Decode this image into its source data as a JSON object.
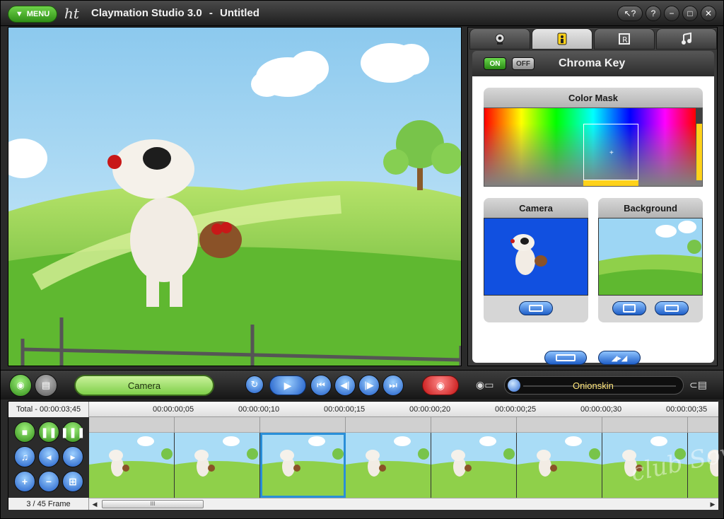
{
  "titlebar": {
    "menu_label": "MENU",
    "logo": "ht",
    "app_name": "Claymation Studio 3.0",
    "separator": "-",
    "document": "Untitled",
    "help_icon": "context-help-icon"
  },
  "right_panel": {
    "tabs": [
      {
        "icon": "webcam-icon",
        "active": false
      },
      {
        "icon": "person-icon",
        "active": true
      },
      {
        "icon": "frame-r-icon",
        "active": false
      },
      {
        "icon": "music-icon",
        "active": false
      }
    ],
    "chroma_key": {
      "on_label": "ON",
      "off_label": "OFF",
      "title": "Chroma Key",
      "color_mask_label": "Color Mask",
      "camera_label": "Camera",
      "background_label": "Background"
    }
  },
  "controls": {
    "camera_pill": "Camera",
    "onionskin_label": "Onionskin"
  },
  "timeline": {
    "total": "Total - 00:00:03;45",
    "ticks": [
      "00:00:00;05",
      "00:00:00;10",
      "00:00:00;15",
      "00:00:00;20",
      "00:00:00;25",
      "00:00:00;30",
      "00:00:00;35"
    ],
    "frame_count": "3 / 45 Frame",
    "selected_frame": 3,
    "scroll_thumb": "III"
  },
  "watermark": "club Sovet",
  "colors": {
    "accent_green": "#4fbf2a",
    "accent_blue": "#1f5dc8",
    "record_red": "#c41212",
    "frame_highlight": "#2a8fd8"
  }
}
